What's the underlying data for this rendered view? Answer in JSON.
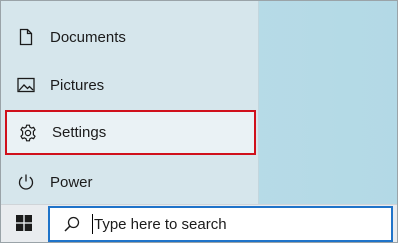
{
  "start_menu": {
    "items": [
      {
        "label": "Documents",
        "icon": "document-icon"
      },
      {
        "label": "Pictures",
        "icon": "pictures-icon"
      },
      {
        "label": "Settings",
        "icon": "gear-icon",
        "highlighted": true
      },
      {
        "label": "Power",
        "icon": "power-icon"
      }
    ]
  },
  "taskbar": {
    "start_icon": "windows-logo-icon",
    "search": {
      "placeholder": "Type here to search",
      "icon": "search-icon"
    }
  },
  "colors": {
    "highlight_border": "#d0101b",
    "search_border": "#1f73c9",
    "menu_background": "#d6e6ec",
    "taskbar_background": "#e9ecef"
  }
}
